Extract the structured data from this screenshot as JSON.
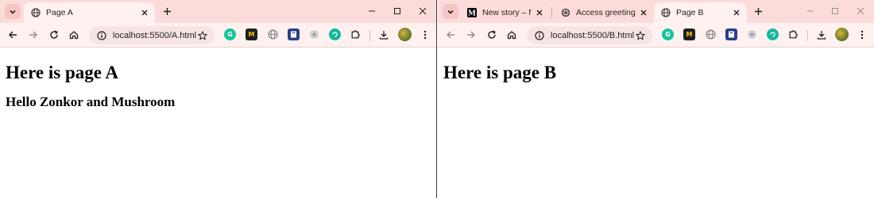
{
  "window_a": {
    "tabs": [
      {
        "title": "Page A",
        "favicon": "globe-icon",
        "active": true
      }
    ],
    "url": "localhost:5500/A.html",
    "page": {
      "heading": "Here is page A",
      "subheading": "Hello Zonkor and Mushroom"
    }
  },
  "window_b": {
    "tabs": [
      {
        "title": "New story – Mediu",
        "favicon": "medium-icon",
        "active": false
      },
      {
        "title": "Access greeting fu",
        "favicon": "openai-icon",
        "active": false
      },
      {
        "title": "Page B",
        "favicon": "globe-icon",
        "active": true
      }
    ],
    "url": "localhost:5500/B.html",
    "page": {
      "heading": "Here is page B"
    }
  },
  "extensions": [
    {
      "name": "grammarly-icon",
      "label": "G",
      "color": "#15c39a"
    },
    {
      "name": "miro-icon",
      "label": "M",
      "color": "#f2c300"
    },
    {
      "name": "globe-extension-icon",
      "label": "",
      "color": "#8a8a8a"
    },
    {
      "name": "book-extension-icon",
      "label": "",
      "color": "#2b3d8a"
    },
    {
      "name": "grey-extension-icon",
      "label": "",
      "color": "#a0a0a0"
    },
    {
      "name": "teal-extension-icon",
      "label": "",
      "color": "#14b8a0"
    },
    {
      "name": "puzzle-icon",
      "label": "",
      "color": "#444444"
    }
  ],
  "colors": {
    "tabstrip": "#fbdcda",
    "toolbar": "#fff1f0",
    "omnibox": "#f6e4e2"
  }
}
